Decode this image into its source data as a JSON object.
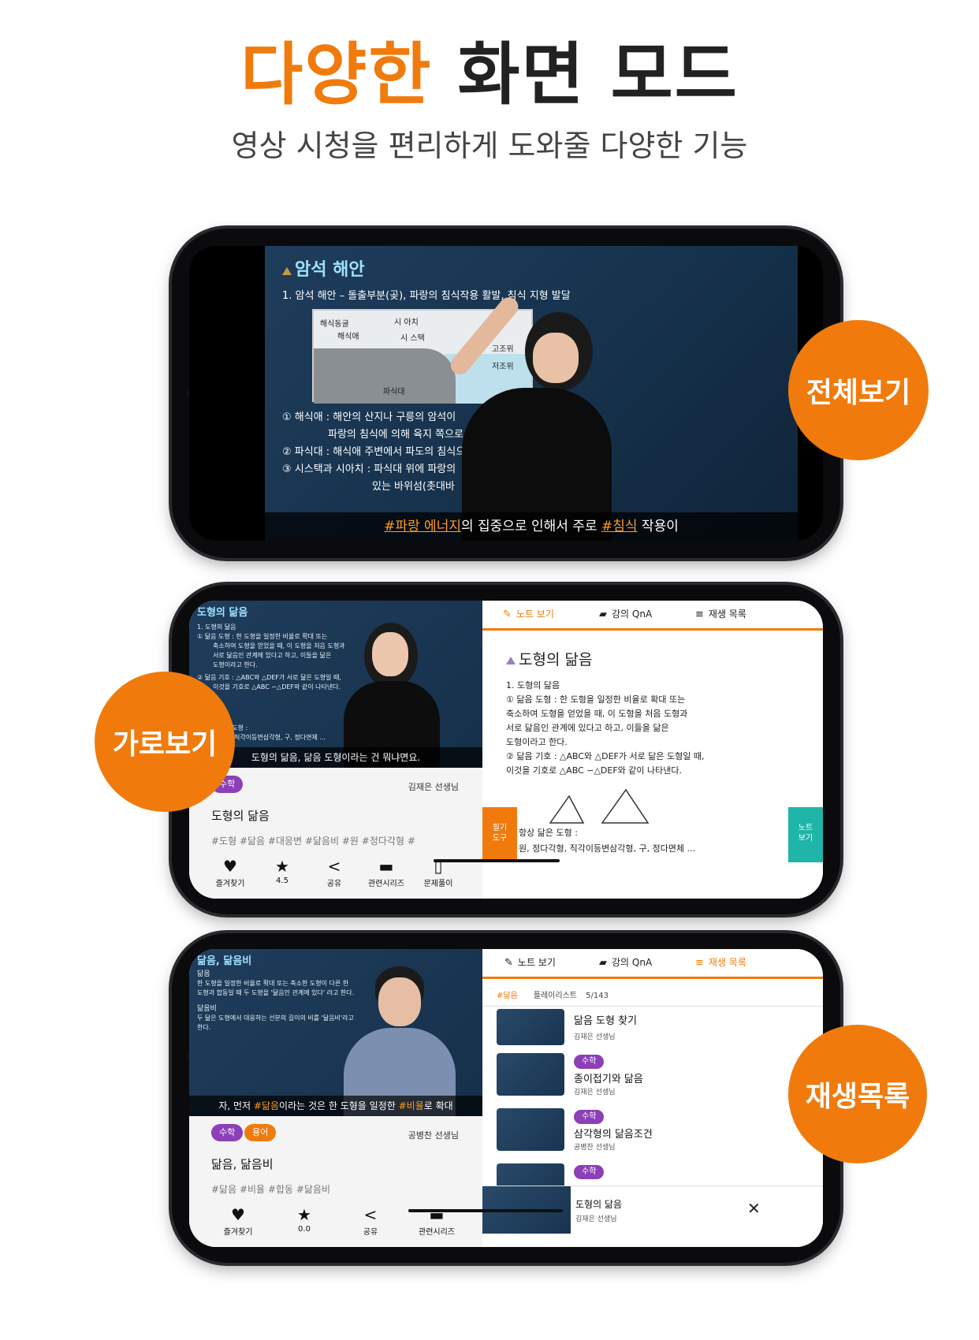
{
  "hero": {
    "accent": "다양한",
    "rest": " 화면 모드",
    "subtitle": "영상 시청을 편리하게 도와줄 다양한 기능"
  },
  "bubbles": {
    "full": "전체보기",
    "landscape": "가로보기",
    "playlist": "재생목록"
  },
  "phone1": {
    "lecture_title": "암석 해안",
    "line1": "1. 암석 해안 – 돌출부분(곶), 파랑의 침식작용 활발, 침식 지형 발달",
    "diagram_labels": [
      "해식동굴",
      "해식애",
      "시 아치",
      "시 스택",
      "고조위",
      "저조위",
      "파식대"
    ],
    "points": [
      "① 해식애 : 해안의 산지나 구릉의 암석이",
      "파랑의 침식에 의해 육지 쪽으로 후퇴",
      "② 파식대 : 해식애 주변에서 파도의 침식으로",
      "③ 시스택과 시아치 : 파식대 위에 파랑의",
      "있는 바위섬(촛대바"
    ],
    "subtitle_hl1": "#파랑 에너지",
    "subtitle_mid": "의 집중으로 인해서 주로 ",
    "subtitle_hl2": "#침식",
    "subtitle_end": " 작용이"
  },
  "phone2": {
    "video_title": "도형의 닮음",
    "video_lines": [
      "1. 도형의 닮음",
      "① 닮음 도형 : 한 도형을 일정한 비율로 확대 또는",
      "축소하여 도형을 얻었을 때, 이 도형을 처음 도형과",
      "서로 닮음인 관계에 있다고 하고, 이들을 닮은",
      "도형이라고 한다.",
      "② 닮음 기호 : △ABC와 △DEF가 서로 닮은 도형일 때,",
      "이것을 기호로 △ABC ∽△DEF와 같이 나타낸다.",
      "③ 항상 닮은 도형 :",
      "원, 정다각형, 직각이등변삼각형, 구, 정다면체 ..."
    ],
    "video_subtitle": "도형의 닮음, 닮음 도형이라는 건 뭐냐면요.",
    "badge": "수학",
    "teacher": "김재은 선생님",
    "title": "도형의 닮음",
    "tags": "#도형   #닮음   #대응변   #닮음비   #원   #정다각형   #",
    "actions": [
      {
        "icon": "♥",
        "label": "즐겨찾기"
      },
      {
        "icon": "★",
        "label": "4.5"
      },
      {
        "icon": "<",
        "label": "공유"
      },
      {
        "icon": "▬",
        "label": "관련시리즈"
      },
      {
        "icon": "▯",
        "label": "문제풀이"
      }
    ],
    "tabs": [
      "노트 보기",
      "강의 QnA",
      "재생 목록"
    ],
    "note_title": "도형의 닮음",
    "note_lines": [
      "1. 도형의 닮음",
      "① 닮음 도형 : 한 도형을 일정한 비율로 확대 또는",
      "      축소하여 도형을 얻었을 때, 이 도형을 처음 도형과",
      "      서로 닮음인 관계에 있다고 하고, 이들을 닮은",
      "      도형이라고 한다.",
      "② 닮음 기호 : △ABC와 △DEF가 서로 닮은 도형일 때,",
      "      이것을 기호로 △ABC ∽△DEF와 같이 나타낸다."
    ],
    "note_bottom1": "항상 닮은 도형 :",
    "note_bottom2": "원, 정다각형, 직각이등변삼각형, 구, 정다면체 ...",
    "left_tool": [
      "필기",
      "도구"
    ],
    "right_tool": [
      "노트",
      "보기"
    ]
  },
  "phone3": {
    "video_title": "닮음, 닮음비",
    "video_lines": [
      "닮음",
      "한 도형을 일정한 비율로 확대 또는 축소한 도형이 다른 한",
      "도형과 합동일 때 두 도형을 '닮음인 관계에 있다' 라고 한다.",
      "닮음비",
      "두 닮은 도형에서 대응하는 선분의 길이의 비를 '닮음비'라고",
      "한다."
    ],
    "sub_pre": "자, 먼저 ",
    "sub_hl1": "#닮음",
    "sub_mid": "이라는 것은 한 도형을 일정한 ",
    "sub_hl2": "#비율",
    "sub_end": "로 확대",
    "badge1": "수학",
    "badge2": "용어",
    "teacher": "공병찬 선생님",
    "title": "닮음, 닮음비",
    "tags": "#닮음   #비율   #합동   #닮음비",
    "actions": [
      {
        "icon": "♥",
        "label": "즐겨찾기"
      },
      {
        "icon": "★",
        "label": "0.0"
      },
      {
        "icon": "<",
        "label": "공유"
      },
      {
        "icon": "▬",
        "label": "관련시리즈"
      }
    ],
    "tabs": [
      "노트 보기",
      "강의 QnA",
      "재생 목록"
    ],
    "playlist_hash": "#닮음",
    "playlist_label": "플레이리스트",
    "playlist_count": "5/143",
    "items": [
      {
        "badge": "",
        "title": "닮음 도형 찾기",
        "teacher": "김재은 선생님"
      },
      {
        "badge": "수학",
        "title": "종이접기와 닮음",
        "teacher": "김재은 선생님"
      },
      {
        "badge": "수학",
        "title": "삼각형의 닮음조건",
        "teacher": "공병찬 선생님"
      }
    ],
    "partial_badge": "수학",
    "mini_title": "도형의 닮음",
    "mini_teacher": "김재은 선생님",
    "close": "✕"
  },
  "colors": {
    "accent": "#f07b0c",
    "purple": "#8c3fb8",
    "teal": "#1fb5a8"
  }
}
